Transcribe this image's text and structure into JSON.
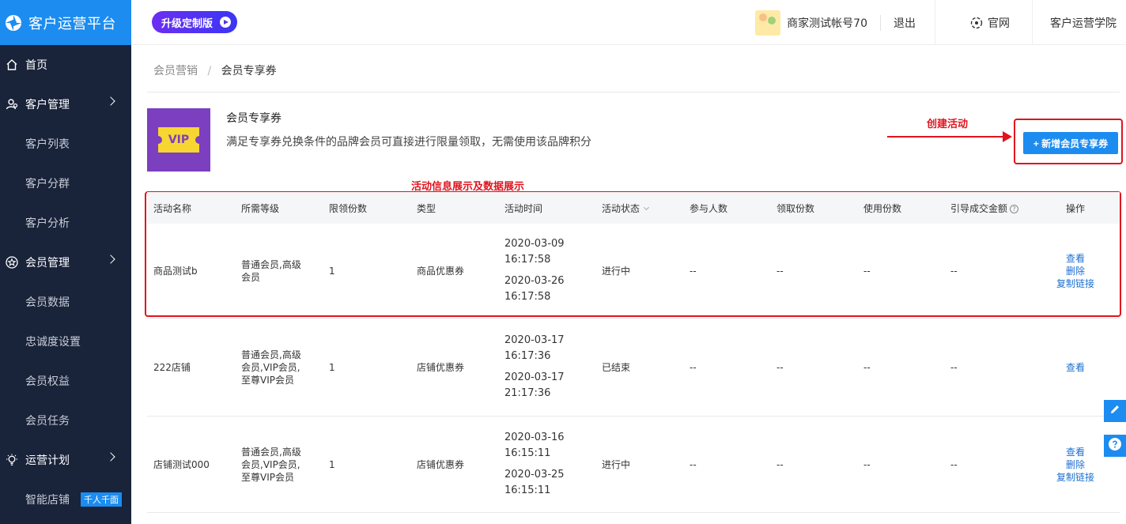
{
  "app": {
    "title": "客户运营平台"
  },
  "sidebar": {
    "items": [
      {
        "label": "首页",
        "icon": "home-icon",
        "level": "top"
      },
      {
        "label": "客户管理",
        "icon": "users-icon",
        "level": "top",
        "expandable": true
      },
      {
        "label": "客户列表",
        "level": "sub"
      },
      {
        "label": "客户分群",
        "level": "sub"
      },
      {
        "label": "客户分析",
        "level": "sub"
      },
      {
        "label": "会员管理",
        "icon": "star-icon",
        "level": "top",
        "expandable": true
      },
      {
        "label": "会员数据",
        "level": "sub"
      },
      {
        "label": "忠诚度设置",
        "level": "sub"
      },
      {
        "label": "会员权益",
        "level": "sub"
      },
      {
        "label": "会员任务",
        "level": "sub"
      },
      {
        "label": "运营计划",
        "icon": "bulb-icon",
        "level": "top",
        "expandable": true
      },
      {
        "label": "智能店铺",
        "level": "sub",
        "badge": "千人千面"
      }
    ]
  },
  "header": {
    "upgrade_label": "升级定制版",
    "account_name": "商家测试帐号70",
    "logout": "退出",
    "official_site": "官网",
    "academy": "客户运营学院"
  },
  "breadcrumb": {
    "parent": "会员营销",
    "sep": "/",
    "current": "会员专享券"
  },
  "intro": {
    "vip_label": "VIP",
    "title": "会员专享券",
    "description": "满足专享券兑换条件的品牌会员可直接进行限量领取，无需使用该品牌积分"
  },
  "annotations": {
    "create": "创建活动",
    "info": "活动信息展示及数据展示"
  },
  "add_button": "+ 新增会员专享券",
  "table": {
    "columns": [
      "活动名称",
      "所需等级",
      "限领份数",
      "类型",
      "活动时间",
      "活动状态",
      "参与人数",
      "领取份数",
      "使用份数",
      "引导成交金额",
      "操作"
    ],
    "rows": [
      {
        "name": "商品测试b",
        "level": "普通会员,高级会员",
        "limit": "1",
        "type": "商品优惠券",
        "start_date": "2020-03-09",
        "start_time": "16:17:58",
        "end_date": "2020-03-26",
        "end_time": "16:17:58",
        "status": "进行中",
        "participants": "--",
        "received": "--",
        "used": "--",
        "amount": "--",
        "actions": [
          "查看",
          "删除",
          "复制链接"
        ]
      },
      {
        "name": "222店铺",
        "level": "普通会员,高级会员,VIP会员,至尊VIP会员",
        "limit": "1",
        "type": "店铺优惠券",
        "start_date": "2020-03-17",
        "start_time": "16:17:36",
        "end_date": "2020-03-17",
        "end_time": "21:17:36",
        "status": "已结束",
        "participants": "--",
        "received": "--",
        "used": "--",
        "amount": "--",
        "actions": [
          "查看"
        ]
      },
      {
        "name": "店铺测试000",
        "level": "普通会员,高级会员,VIP会员,至尊VIP会员",
        "limit": "1",
        "type": "店铺优惠券",
        "start_date": "2020-03-16",
        "start_time": "16:15:11",
        "end_date": "2020-03-25",
        "end_time": "16:15:11",
        "status": "进行中",
        "participants": "--",
        "received": "--",
        "used": "--",
        "amount": "--",
        "actions": [
          "查看",
          "删除",
          "复制链接"
        ]
      }
    ]
  },
  "float_buttons": [
    "edit-icon",
    "help-icon"
  ],
  "colors": {
    "primary": "#1c8cf0",
    "sidebar": "#19233a",
    "annotation": "#e0141e",
    "vip": "#7b3fbf"
  }
}
